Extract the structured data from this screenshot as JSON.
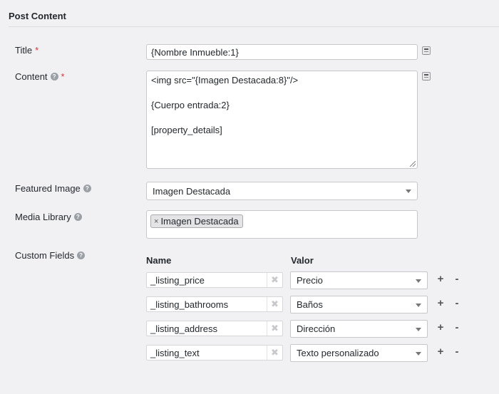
{
  "section": {
    "title": "Post Content"
  },
  "title_field": {
    "label": "Title",
    "required_mark": "*",
    "value": "{Nombre Inmueble:1}"
  },
  "content_field": {
    "label": "Content",
    "required_mark": "*",
    "help": "?",
    "lines": [
      "<img src=\"{Imagen Destacada:8}\"/>",
      "{Cuerpo entrada:2}",
      "[property_details]"
    ]
  },
  "featured_image": {
    "label": "Featured Image",
    "help": "?",
    "value": "Imagen Destacada"
  },
  "media_library": {
    "label": "Media Library",
    "help": "?",
    "chip_remove": "×",
    "chip_label": "Imagen Destacada"
  },
  "custom_fields": {
    "label": "Custom Fields",
    "help": "?",
    "col_name": "Name",
    "col_valor": "Valor",
    "clear_glyph": "✖",
    "plus": "+",
    "minus": "-",
    "rows": [
      {
        "name": "_listing_price",
        "valor": "Precio"
      },
      {
        "name": "_listing_bathrooms",
        "valor": "Baños"
      },
      {
        "name": "_listing_address",
        "valor": "Dirección"
      },
      {
        "name": "_listing_text",
        "valor": "Texto personalizado"
      }
    ]
  },
  "colors": {
    "required": "#d63638",
    "background": "#f1f1f3",
    "border": "#c6c6cb"
  }
}
